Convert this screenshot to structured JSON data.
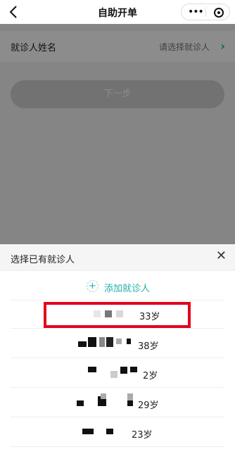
{
  "nav": {
    "title": "自助开单",
    "back_icon": "back-chevron-icon",
    "more_icon": "more-dots-icon",
    "close_icon": "target-close-icon",
    "more_label": "•••"
  },
  "form": {
    "patient_label": "就诊人姓名",
    "patient_placeholder": "请选择就诊人",
    "arrow": "›",
    "next_button": "下一步"
  },
  "sheet": {
    "title": "选择已有就诊人",
    "close": "✕",
    "add_label": "添加就诊人",
    "add_icon": "+",
    "patients": [
      {
        "age": "33岁"
      },
      {
        "age": "38岁"
      },
      {
        "age": "2岁"
      },
      {
        "age": "29岁"
      },
      {
        "age": "23岁"
      }
    ]
  },
  "colors": {
    "accent": "#1fb0a8",
    "highlight": "#e3001b"
  }
}
